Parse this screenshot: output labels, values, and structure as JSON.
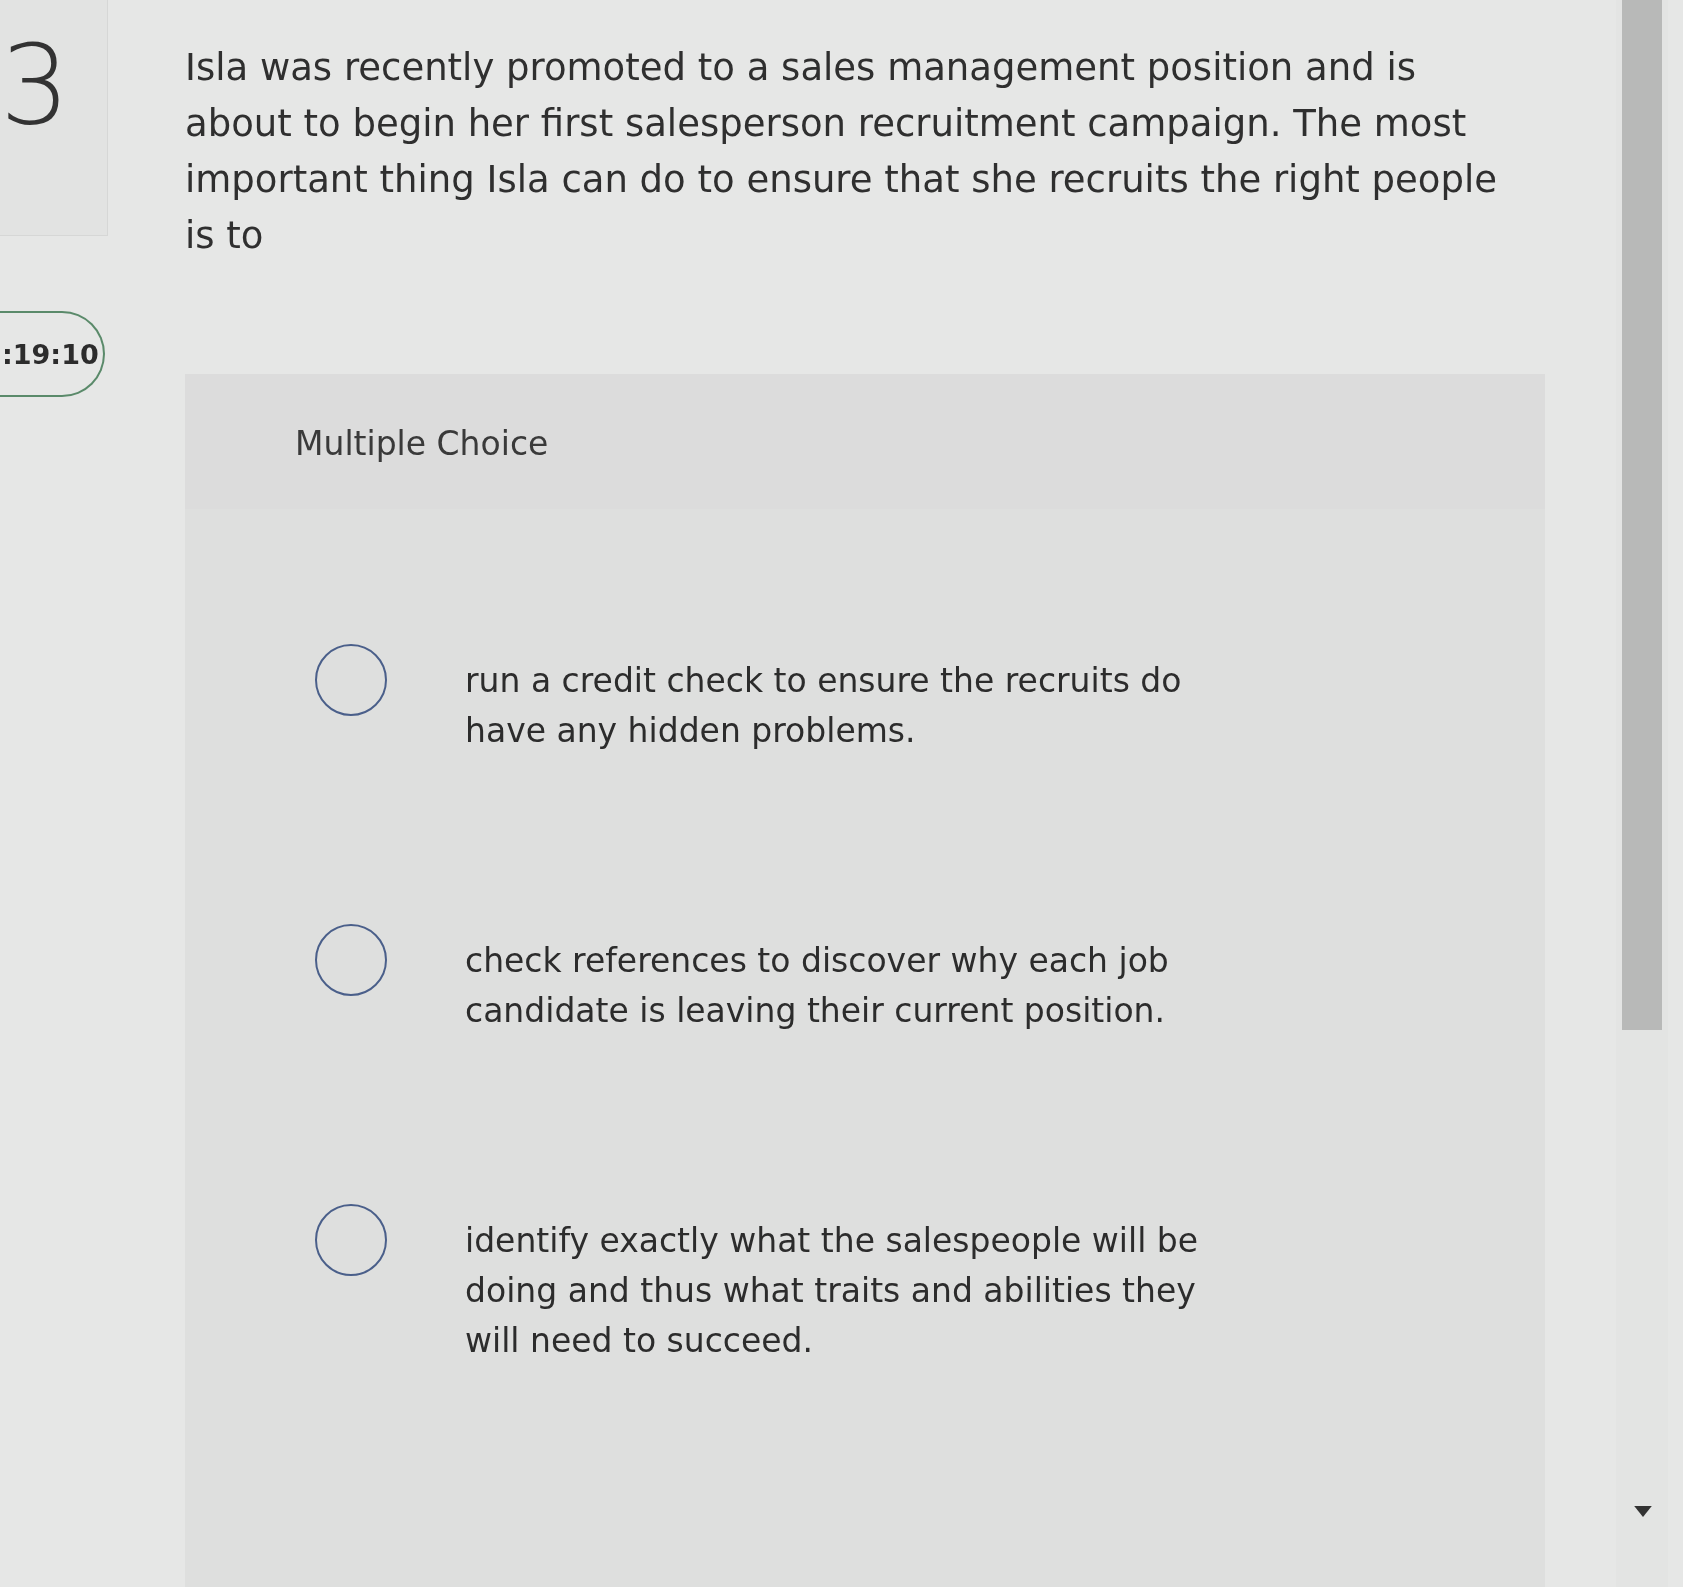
{
  "question_number": "3",
  "timer": ":19:10",
  "question": "Isla was recently promoted to a sales management position and is about to begin her first salesperson recruitment campaign. The most important thing Isla can do to ensure that she recruits the right people is to",
  "answer_card": {
    "heading": "Multiple Choice",
    "options": [
      {
        "text": "run a credit check to ensure the recruits do have any hidden problems.",
        "selected": false
      },
      {
        "text": "check references to discover why each job candidate is leaving their current position.",
        "selected": false
      },
      {
        "text": "identify exactly what the salespeople will be doing and thus what traits and abilities they will need to succeed.",
        "selected": false
      }
    ]
  }
}
